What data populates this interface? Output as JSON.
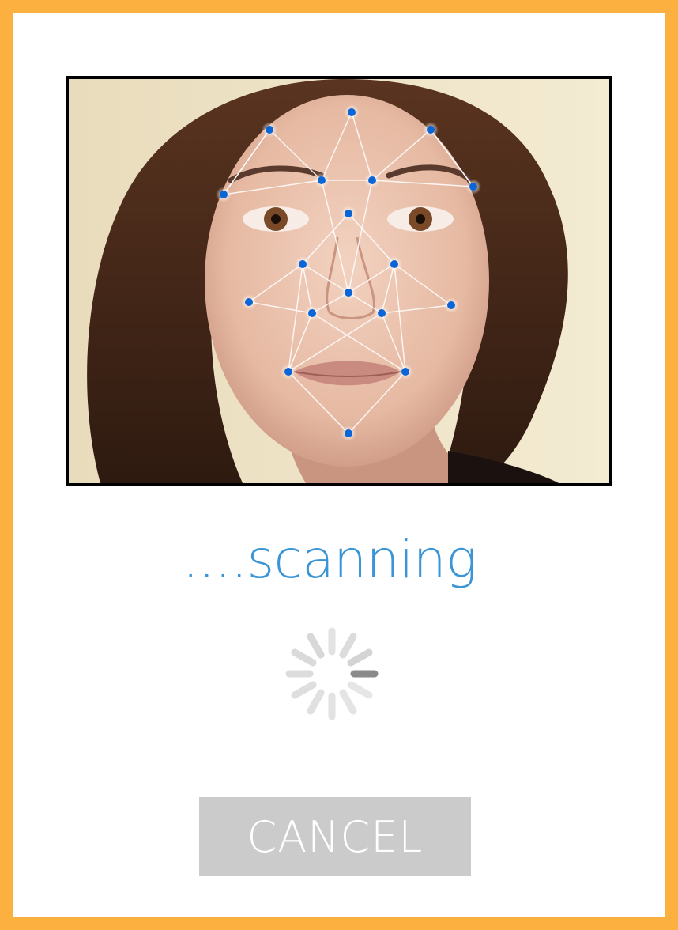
{
  "status": {
    "text": "....scanning"
  },
  "actions": {
    "cancel_label": "CANCEL"
  },
  "colors": {
    "frame": "#FBB040",
    "status_text": "#3A95D6",
    "landmark_dot": "#0A66D6",
    "cancel_bg": "#CBCBCB"
  },
  "icons": {
    "loader": "spinner-icon"
  }
}
